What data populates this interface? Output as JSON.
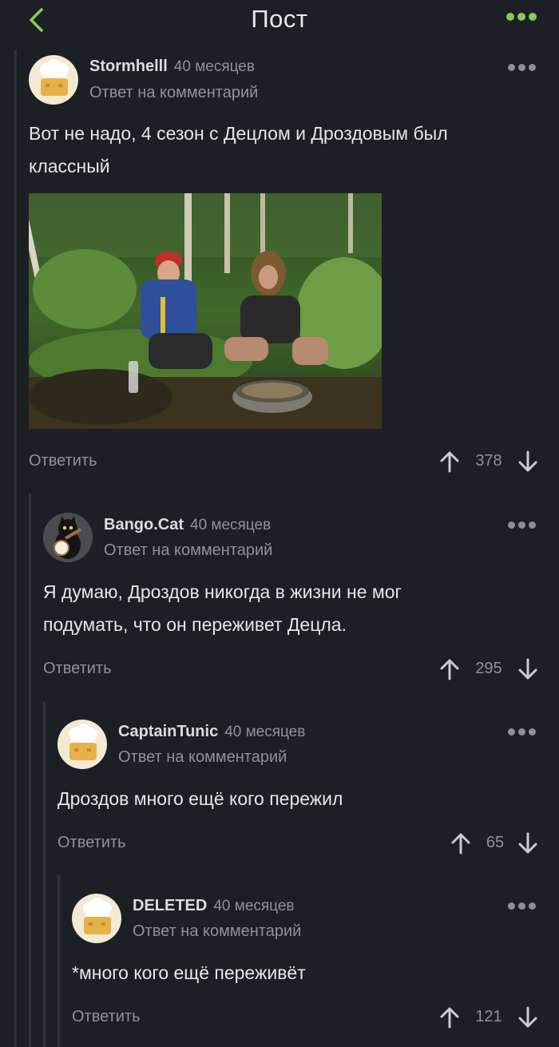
{
  "header": {
    "title": "Пост"
  },
  "comments": [
    {
      "author": "Stormhelll",
      "time": "40 месяцев",
      "reply_to": "Ответ на комментарий",
      "text_lines": [
        "Вот не надо, 4 сезон с Децлом и Дроздовым был",
        "классный"
      ],
      "reply_label": "Ответить",
      "rating": "378",
      "avatar": "chef-hat-avatar-icon"
    },
    {
      "author": "Bango.Cat",
      "time": "40 месяцев",
      "reply_to": "Ответ на комментарий",
      "text_lines": [
        "Я думаю, Дроздов никогда в жизни не мог",
        "подумать, что он переживет Децла."
      ],
      "reply_label": "Ответить",
      "rating": "295",
      "avatar": "cat-with-banjo-avatar-icon"
    },
    {
      "author": "CaptainTunic",
      "time": "40 месяцев",
      "reply_to": "Ответ на комментарий",
      "text_lines": [
        "Дроздов много ещё кого пережил"
      ],
      "reply_label": "Ответить",
      "rating": "65",
      "avatar": "chef-hat-avatar-icon"
    },
    {
      "author": "DELETED",
      "time": "40 месяцев",
      "reply_to": "Ответ на комментарий",
      "text_lines": [
        "*много кого ещё переживёт"
      ],
      "reply_label": "Ответить",
      "rating": "121",
      "avatar": "chef-hat-avatar-icon"
    }
  ],
  "colors": {
    "background": "#1c2024",
    "accent": "#8ac858",
    "muted": "#8e9398"
  }
}
